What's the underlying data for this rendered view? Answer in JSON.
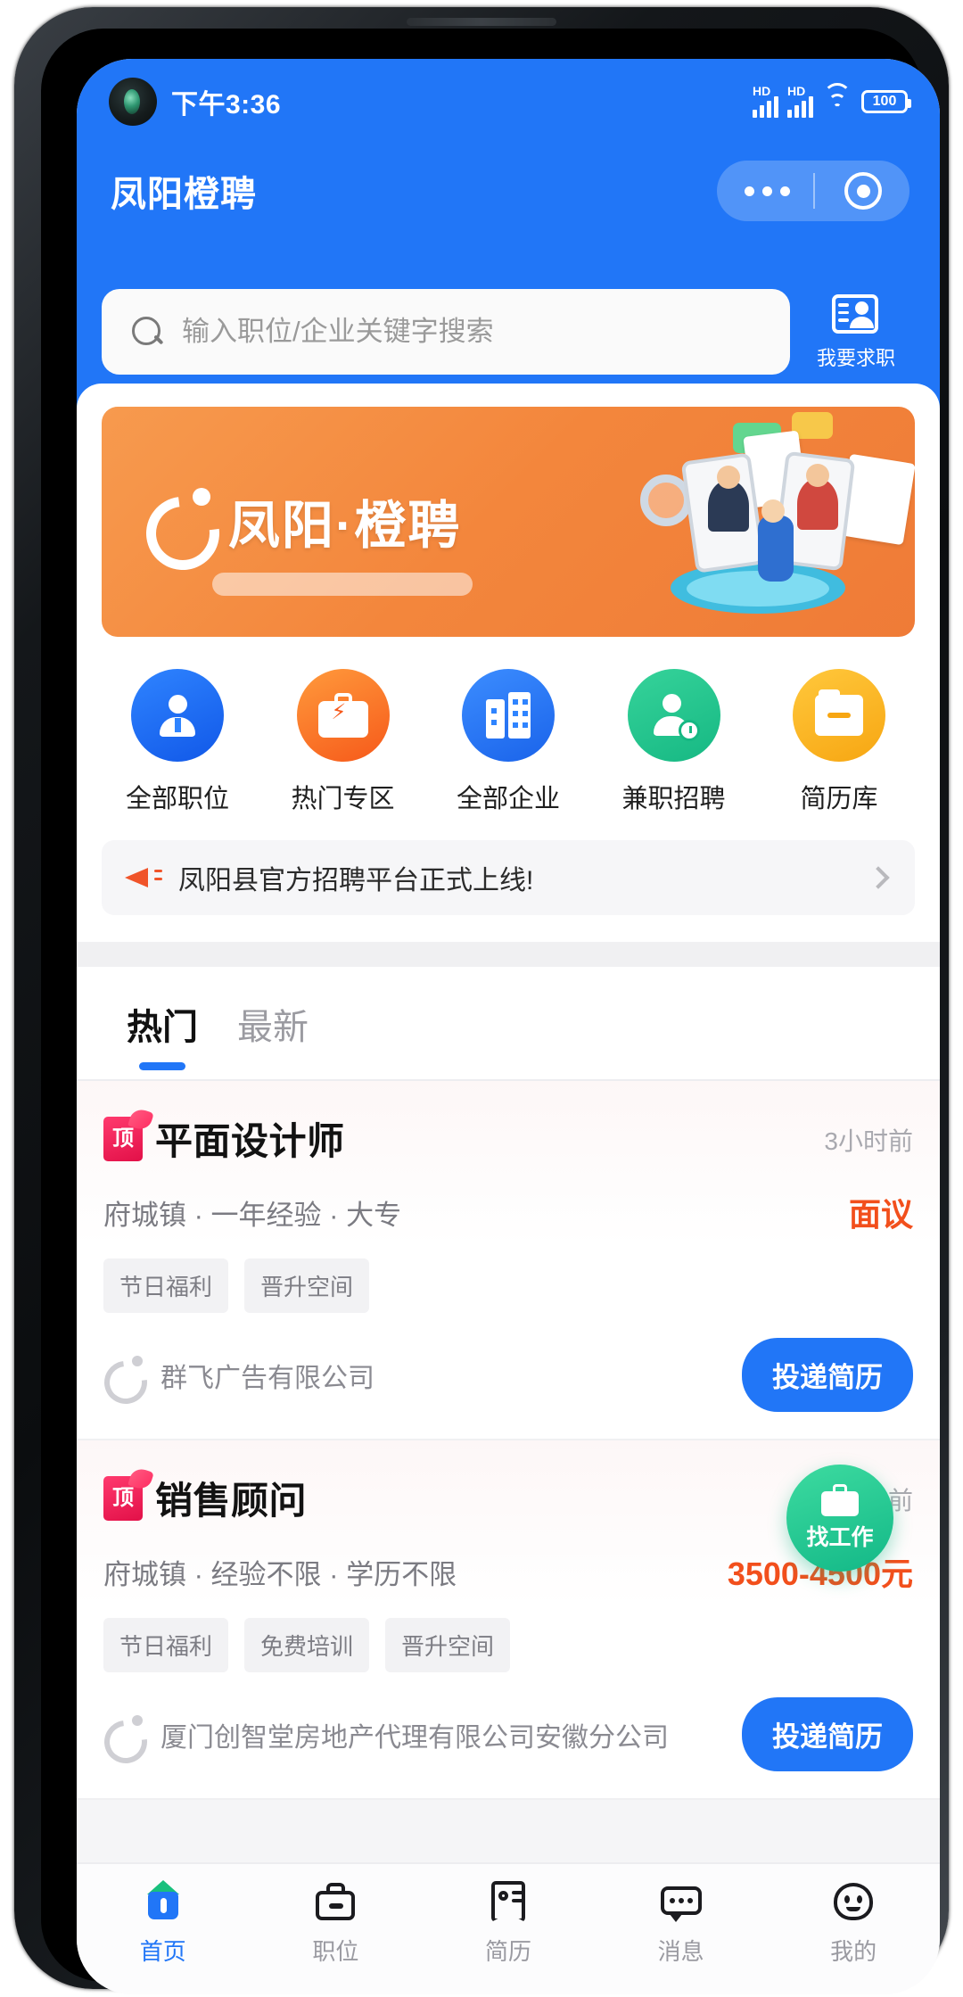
{
  "statusbar": {
    "time": "下午3:36",
    "hd_label_1": "HD",
    "hd_label_2": "HD",
    "wifi_icon": "wifi-icon",
    "battery_level": "100"
  },
  "header": {
    "app_title": "凤阳橙聘",
    "capsule": {
      "more_icon": "more-dots-icon",
      "target_icon": "target-circle-icon"
    },
    "search": {
      "placeholder": "输入职位/企业关键字搜索",
      "value": "",
      "icon": "search-icon"
    },
    "jobseeker": {
      "label": "我要求职",
      "icon": "resume-person-icon"
    },
    "bg_color": "#2176f7"
  },
  "banner": {
    "brand_text": "凤阳·橙聘",
    "logo_icon": "orange-c-mark-icon",
    "bg_color": "#f3863c"
  },
  "categories": [
    {
      "label": "全部职位",
      "icon": "person-tie-icon",
      "color": "#1158e8"
    },
    {
      "label": "热门专区",
      "icon": "briefcase-bolt-icon",
      "color": "#f6591a"
    },
    {
      "label": "全部企业",
      "icon": "building-icon",
      "color": "#1a63ea"
    },
    {
      "label": "兼职招聘",
      "icon": "person-clock-icon",
      "color": "#16b883"
    },
    {
      "label": "简历库",
      "icon": "folder-icon",
      "color": "#f7a612"
    }
  ],
  "notice": {
    "icon": "megaphone-icon",
    "text": "凤阳县官方招聘平台正式上线!",
    "chevron_icon": "chevron-right-icon"
  },
  "tabs": [
    {
      "label": "热门",
      "active": true
    },
    {
      "label": "最新",
      "active": false
    }
  ],
  "jobs": [
    {
      "badge": "顶",
      "title": "平面设计师",
      "time": "3小时前",
      "meta": "府城镇 · 一年经验 · 大专",
      "salary": "面议",
      "tags": [
        "节日福利",
        "晋升空间"
      ],
      "company": "群飞广告有限公司",
      "company_logo_icon": "company-c-logo-icon",
      "apply_label": "投递简历"
    },
    {
      "badge": "顶",
      "title": "销售顾问",
      "time": "5小时前",
      "meta": "府城镇 · 经验不限 · 学历不限",
      "salary": "3500-4500元",
      "tags": [
        "节日福利",
        "免费培训",
        "晋升空间"
      ],
      "company": "厦门创智堂房地产代理有限公司安徽分公司",
      "company_logo_icon": "company-c-logo-icon",
      "apply_label": "投递简历"
    }
  ],
  "fab": {
    "label": "找工作",
    "icon": "briefcase-icon",
    "color": "#13b887"
  },
  "bottom_nav": [
    {
      "label": "首页",
      "icon": "home-icon",
      "active": true
    },
    {
      "label": "职位",
      "icon": "briefcase-icon",
      "active": false
    },
    {
      "label": "简历",
      "icon": "resume-icon",
      "active": false
    },
    {
      "label": "消息",
      "icon": "message-icon",
      "active": false
    },
    {
      "label": "我的",
      "icon": "profile-icon",
      "active": false
    }
  ],
  "accent": {
    "primary": "#2176f7",
    "salary": "#f24f1c",
    "brand_orange": "#f3863c"
  }
}
